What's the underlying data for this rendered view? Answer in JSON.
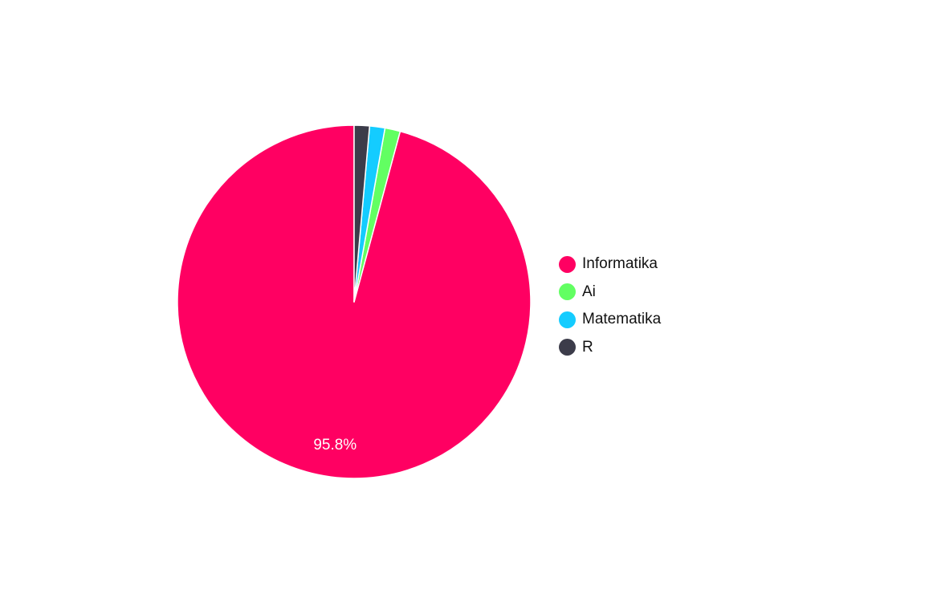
{
  "chart_data": {
    "type": "pie",
    "categories": [
      "Informatika",
      "Ai",
      "Matematika",
      "R"
    ],
    "values": [
      95.8,
      1.4,
      1.4,
      1.4
    ],
    "colors": [
      "#ff0062",
      "#62ff62",
      "#14ccff",
      "#3c3c4a"
    ],
    "data_labels": [
      "95.8%",
      "",
      "",
      ""
    ],
    "legend_position": "right",
    "start_angle": "top",
    "direction": "counterclockwise"
  },
  "legend": {
    "items": [
      {
        "label": "Informatika",
        "color": "#ff0062"
      },
      {
        "label": "Ai",
        "color": "#62ff62"
      },
      {
        "label": "Matematika",
        "color": "#14ccff"
      },
      {
        "label": "R",
        "color": "#3c3c4a"
      }
    ]
  }
}
